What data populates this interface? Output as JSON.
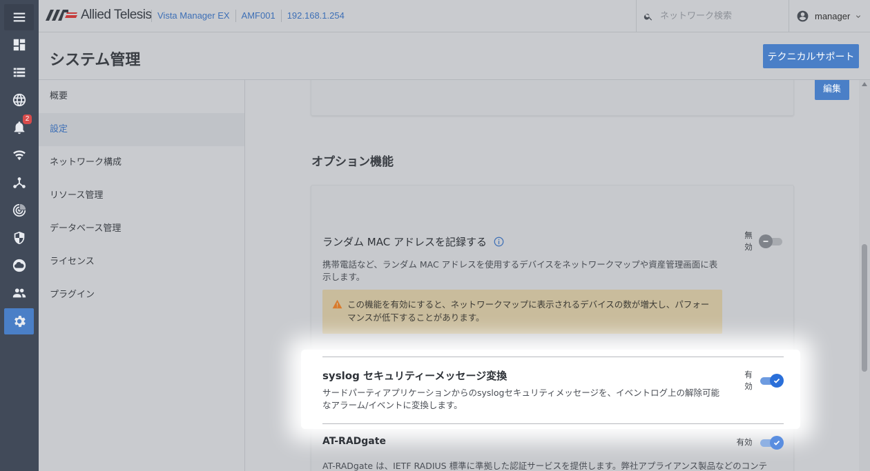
{
  "header": {
    "brand": "Allied Telesis",
    "breadcrumbs": [
      "Vista Manager EX",
      "AMF001",
      "192.168.1.254"
    ],
    "search_placeholder": "ネットワーク検索",
    "username": "manager"
  },
  "rail": {
    "alerts_badge": "2",
    "active": "settings"
  },
  "page": {
    "title": "システム管理",
    "support_button": "テクニカルサポート"
  },
  "subnav": {
    "items": [
      {
        "label": "概要"
      },
      {
        "label": "設定"
      },
      {
        "label": "ネットワーク構成"
      },
      {
        "label": "リソース管理"
      },
      {
        "label": "データベース管理"
      },
      {
        "label": "ライセンス"
      },
      {
        "label": "プラグイン"
      }
    ],
    "active_index": 1
  },
  "content": {
    "edit_button": "編集",
    "section_title": "オプション機能",
    "options": [
      {
        "title": "ランダム MAC アドレスを記録する",
        "description": "携帯電話など、ランダム MAC アドレスを使用するデバイスをネットワークマップや資産管理画面に表示します。",
        "warning": "この機能を有効にすると、ネットワークマップに表示されるデバイスの数が増大し、パフォーマンスが低下することがあります。",
        "state_label": "無効",
        "enabled": false
      },
      {
        "title": "syslog セキュリティーメッセージ変換",
        "description": "サードパーティアプリケーションからのsyslogセキュリティメッセージを、イベントログ上の解除可能なアラーム/イベントに変換します。",
        "state_label": "有効",
        "enabled": true
      },
      {
        "title": "AT-RADgate",
        "description": "AT-RADgate は、IETF RADIUS 標準に準拠した認証サービスを提供します。弊社アプライアンス製品などのコンテ",
        "state_label": "有効",
        "enabled": true
      }
    ]
  },
  "colors": {
    "accent": "#4a7fc7",
    "rail": "#414a59",
    "toggle_on": "#2a6fd9",
    "warning_bg": "#c9bc9c"
  }
}
